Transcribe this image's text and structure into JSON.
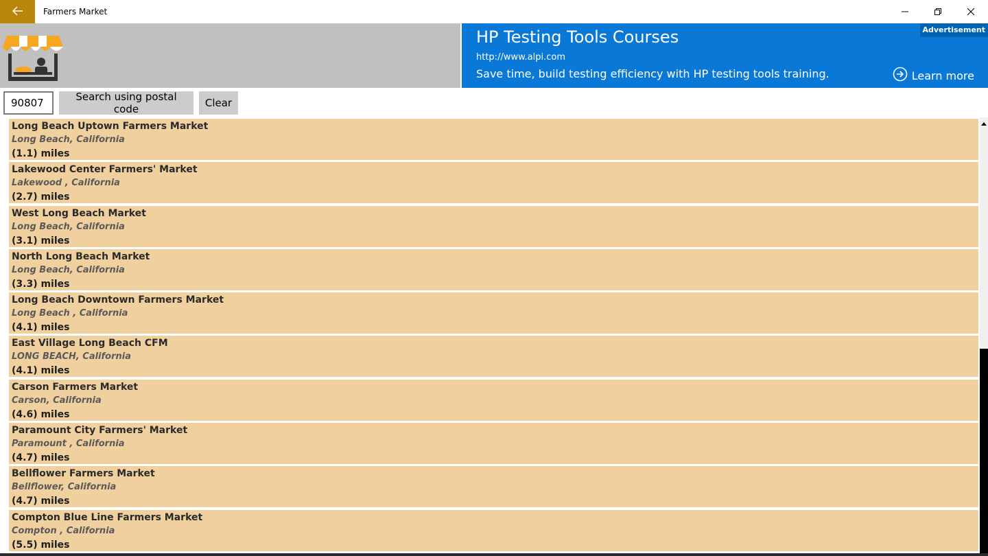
{
  "window": {
    "title": "Farmers Market"
  },
  "icons": {
    "back": "back-arrow-icon",
    "minimize": "minimize-icon",
    "maximize": "restore-icon",
    "close": "close-icon",
    "logo": "market-stall-logo",
    "learn_more": "arrow-circle-right-icon"
  },
  "colors": {
    "accent": "#b8860b",
    "ad_blue": "#0a78d7",
    "item_bg": "#f0d09e",
    "header_gray": "#c0c0c0"
  },
  "ad": {
    "badge": "Advertisement",
    "title": "HP Testing Tools Courses",
    "url": "http://www.alpi.com",
    "description": "Save time, build testing efficiency with HP testing tools training.",
    "learn_more": "Learn more"
  },
  "search": {
    "postal_code": "90807",
    "search_label": "Search using postal code",
    "clear_label": "Clear"
  },
  "markets": [
    {
      "name": "Long Beach Uptown Farmers Market",
      "location": "Long Beach, California",
      "distance": "(1.1) miles"
    },
    {
      "name": "Lakewood Center Farmers' Market",
      "location": "Lakewood , California",
      "distance": "(2.7) miles"
    },
    {
      "name": "West Long Beach Market",
      "location": "Long Beach, California",
      "distance": "(3.1) miles"
    },
    {
      "name": "North Long Beach Market",
      "location": "Long Beach, California",
      "distance": "(3.3) miles"
    },
    {
      "name": "Long Beach Downtown Farmers Market",
      "location": "Long Beach , California",
      "distance": "(4.1) miles"
    },
    {
      "name": "East Village Long Beach CFM",
      "location": "LONG BEACH, California",
      "distance": "(4.1) miles"
    },
    {
      "name": "Carson Farmers Market",
      "location": "Carson, California",
      "distance": "(4.6) miles"
    },
    {
      "name": "Paramount City Farmers' Market",
      "location": "Paramount , California",
      "distance": "(4.7) miles"
    },
    {
      "name": "Bellflower Farmers Market",
      "location": "Bellflower, California",
      "distance": "(4.7) miles"
    },
    {
      "name": "Compton Blue Line Farmers Market",
      "location": "Compton , California",
      "distance": "(5.5) miles"
    }
  ]
}
